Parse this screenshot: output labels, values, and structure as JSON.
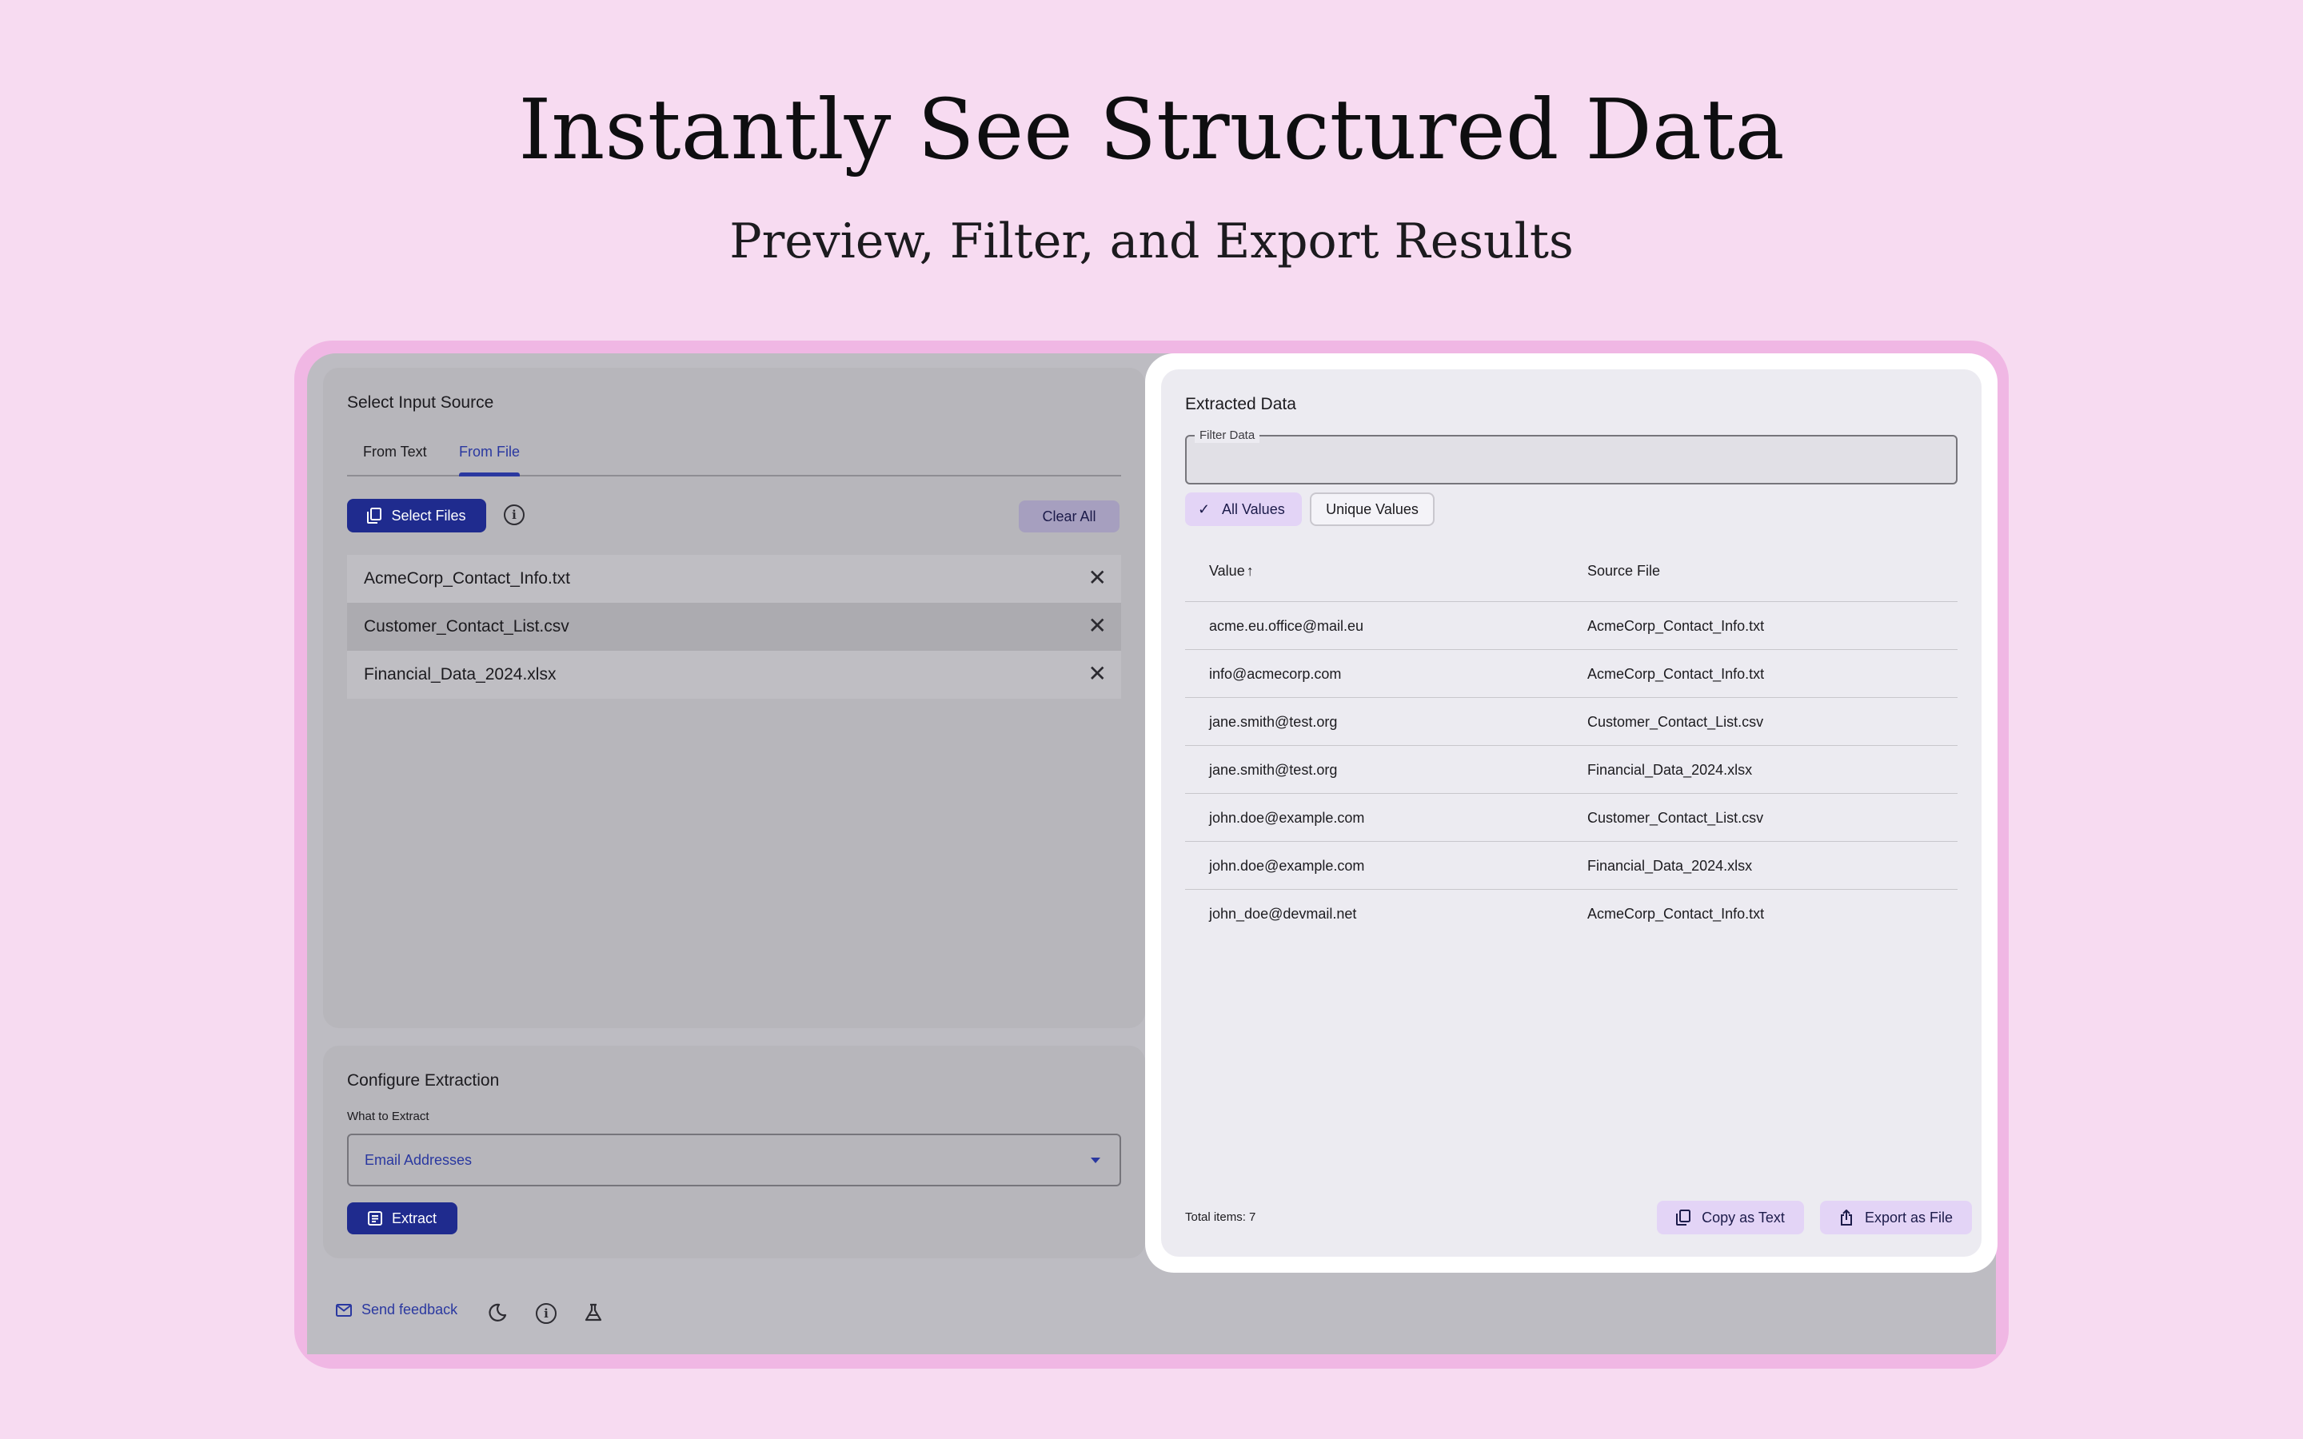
{
  "hero": {
    "title": "Instantly See Structured Data",
    "subtitle": "Preview, Filter, and Export Results"
  },
  "input_source": {
    "title": "Select Input Source",
    "tabs": [
      {
        "label": "From Text",
        "active": false
      },
      {
        "label": "From File",
        "active": true
      }
    ],
    "select_files_label": "Select Files",
    "clear_all_label": "Clear All",
    "files": [
      {
        "name": "AcmeCorp_Contact_Info.txt"
      },
      {
        "name": "Customer_Contact_List.csv"
      },
      {
        "name": "Financial_Data_2024.xlsx"
      }
    ]
  },
  "configure": {
    "title": "Configure Extraction",
    "what_label": "What to Extract",
    "selected_value": "Email Addresses",
    "extract_label": "Extract"
  },
  "footer": {
    "send_feedback_label": "Send feedback"
  },
  "extracted": {
    "title": "Extracted Data",
    "filter_label": "Filter Data",
    "filter_value": "",
    "chip_all": "All Values",
    "chip_unique": "Unique Values",
    "columns": [
      "Value",
      "Source File"
    ],
    "sort_indicator": "↑",
    "rows": [
      {
        "value": "acme.eu.office@mail.eu",
        "source": "AcmeCorp_Contact_Info.txt"
      },
      {
        "value": "info@acmecorp.com",
        "source": "AcmeCorp_Contact_Info.txt"
      },
      {
        "value": "jane.smith@test.org",
        "source": "Customer_Contact_List.csv"
      },
      {
        "value": "jane.smith@test.org",
        "source": "Financial_Data_2024.xlsx"
      },
      {
        "value": "john.doe@example.com",
        "source": "Customer_Contact_List.csv"
      },
      {
        "value": "john.doe@example.com",
        "source": "Financial_Data_2024.xlsx"
      },
      {
        "value": "john_doe@devmail.net",
        "source": "AcmeCorp_Contact_Info.txt"
      }
    ],
    "total_label": "Total items: 7",
    "copy_label": "Copy as Text",
    "export_label": "Export as File"
  },
  "colors": {
    "page_bg": "#f7dbf1",
    "frame": "#f0b7e4",
    "primary": "#1f2b8e",
    "tonal": "#e3d4f6"
  },
  "icons": [
    "copy-icon",
    "info-icon",
    "close-icon",
    "list-icon",
    "mail-icon",
    "moon-icon",
    "flask-icon",
    "check-icon",
    "sort-up-icon",
    "share-icon",
    "dropdown-caret-icon"
  ]
}
